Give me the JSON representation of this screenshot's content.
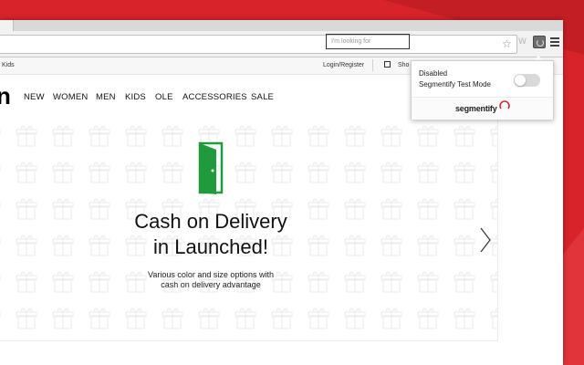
{
  "browser": {
    "toolbar": {
      "star_icon": "star-icon",
      "ext_w_label": "W"
    }
  },
  "site": {
    "top_strip": {
      "kids": "Kids",
      "login": "Login/Register",
      "shop": "Sho"
    },
    "logo": "n",
    "nav": [
      "NEW",
      "WOMEN",
      "MEN",
      "KIDS",
      "OLE",
      "ACCESSORIES",
      "SALE"
    ],
    "search": {
      "placeholder": "I'm looking for"
    },
    "hero": {
      "headline_line1": "Cash on Delivery",
      "headline_line2": "in Launched!",
      "sub_line1": "Various color and size options with",
      "sub_line2": "cash on delivery advantage",
      "door_color": "#1f9a3c"
    }
  },
  "popup": {
    "status": "Disabled",
    "mode": "Segmentify Test Mode",
    "toggle_on": false,
    "brand": "segmentify",
    "brand_accent": "#d8232a"
  },
  "colors": {
    "background": "#d8232a"
  }
}
